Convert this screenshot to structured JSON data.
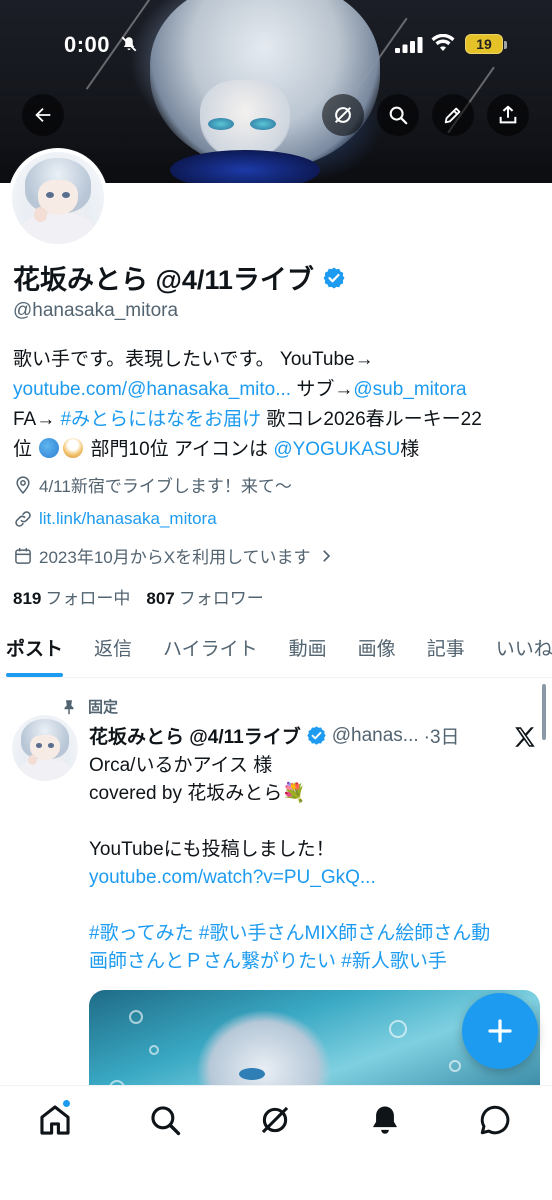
{
  "status_bar": {
    "time": "0:00",
    "battery": "19"
  },
  "profile": {
    "name": "花坂みとら @4/11ライブ",
    "handle": "@hanasaka_mitora",
    "bio": {
      "line1": "歌い手です。表現したいです。 YouTube→",
      "line2_link": "youtube.com/@hanasaka_mito...",
      "line2_mid": " サブ→",
      "line2_mention": "@sub_mitora",
      "line3_pre": "FA→ ",
      "line3_hashtag": "#みとらにはなをお届け",
      "line3_post": " 歌コレ2026春ルーキー22",
      "line4_pre": "位 ",
      "line4_post": " 部門10位 アイコンは ",
      "line4_mention": "@YOGUKASU",
      "line4_end": "様"
    },
    "location": "4/11新宿でライブします！来て〜",
    "website": "lit.link/hanasaka_mitora",
    "joined": "2023年10月からXを利用しています",
    "following_count": "819",
    "following_label": "フォロー中",
    "followers_count": "807",
    "followers_label": "フォロワー"
  },
  "tabs": [
    "ポスト",
    "返信",
    "ハイライト",
    "動画",
    "画像",
    "記事",
    "いいね"
  ],
  "post": {
    "pinned_label": "固定",
    "author_name": "花坂みとら @4/11ライブ",
    "author_handle": "@hanas...",
    "time": "·3日",
    "line1": "Orca/いるかアイス 様",
    "line2": "covered by 花坂みとら💐",
    "line3": "",
    "line4": "YouTubeにも投稿しました！",
    "line5_link": "youtube.com/watch?v=PU_GkQ...",
    "line6": "",
    "line7_tags": "#歌ってみた #歌い手さんMIX師さん絵師さん動",
    "line8_tags": "画師さんとＰさん繋がりたい #新人歌い手"
  },
  "colors": {
    "accent": "#1d9bf0",
    "secondary_text": "#536471",
    "text": "#0f1419"
  },
  "icons": {
    "header": [
      "back-arrow-icon",
      "grok-icon",
      "search-icon",
      "edit-icon",
      "share-icon"
    ],
    "nav": [
      "home-icon",
      "search-icon",
      "grok-icon",
      "notifications-icon",
      "messages-icon"
    ]
  }
}
